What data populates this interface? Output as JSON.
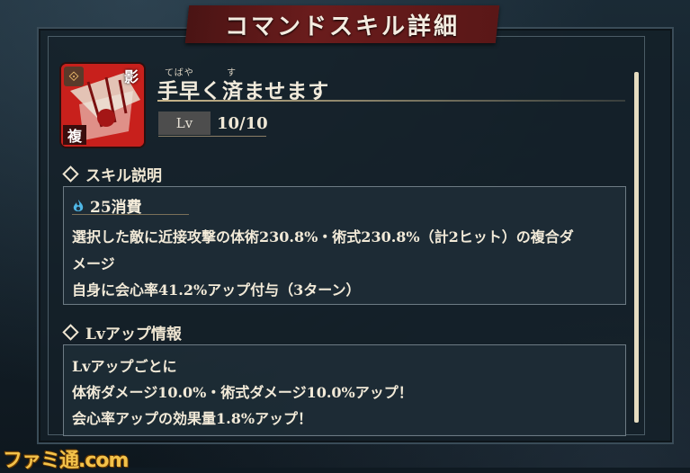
{
  "title": "コマンドスキル詳細",
  "skill": {
    "icon_badge_left": "⟐",
    "icon_badge_right": "影",
    "icon_badge_bottom": "複",
    "ruby_1": "てばや",
    "ruby_2": "す",
    "name": "手早く済ませます",
    "lv_label": "Lv",
    "lv_value": "10/10"
  },
  "description": {
    "heading": "スキル説明",
    "cost": "25消費",
    "lines": [
      "選択した敵に近接攻撃の体術230.8%・術式230.8%（計2ヒット）の複合ダ",
      "メージ",
      "自身に会心率41.2%アップ付与（3ターン）"
    ]
  },
  "lvup": {
    "heading": "Lvアップ情報",
    "lines": [
      "Lvアップごとに",
      "体術ダメージ10.0%・術式ダメージ10.0%アップ！",
      "会心率アップの効果量1.8%アップ！"
    ]
  },
  "watermark": "ファミ通.com",
  "colors": {
    "banner": "#6a1c1c",
    "icon_bg": "#c8201c",
    "cost_icon": "#4fb7e6"
  }
}
